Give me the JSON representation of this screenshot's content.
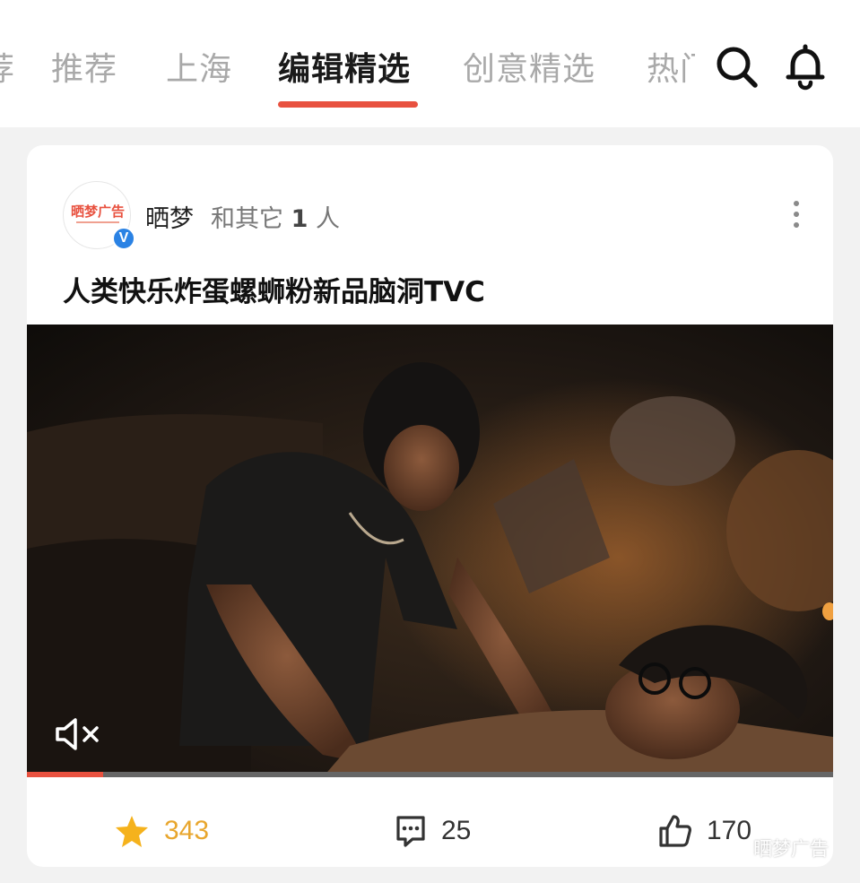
{
  "tabs": [
    {
      "label": "荐",
      "active": false
    },
    {
      "label": "推荐",
      "active": false
    },
    {
      "label": "上海",
      "active": false
    },
    {
      "label": "编辑精选",
      "active": true
    },
    {
      "label": "创意精选",
      "active": false
    },
    {
      "label": "热门",
      "active": false
    }
  ],
  "header": {
    "search_icon": "search-icon",
    "bell_icon": "bell-icon"
  },
  "post": {
    "author": {
      "avatar_text": "晒梦广告",
      "name": "晒梦",
      "extra_prefix": "和其它",
      "extra_count": "1",
      "extra_suffix": "人",
      "verified_badge": "V"
    },
    "title": "人类快乐炸蛋螺蛳粉新品脑洞TVC",
    "video": {
      "muted": true,
      "progress": 0.095
    },
    "actions": {
      "favorites": "343",
      "comments": "25",
      "likes": "170"
    }
  },
  "watermark": {
    "text": "晒梦广告"
  },
  "colors": {
    "accent": "#e8513f",
    "fav_star": "#f5b21c",
    "fav_count": "#e8a62d",
    "verified": "#2a82e4",
    "text_primary": "#222222",
    "text_muted": "#999999"
  }
}
